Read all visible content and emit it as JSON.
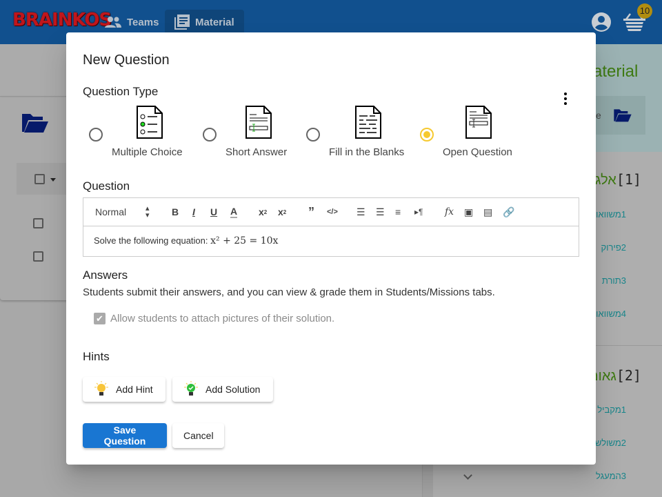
{
  "app": {
    "logo": "BRAINKOS",
    "nav": [
      {
        "label": "Teams",
        "icon": "people-icon"
      },
      {
        "label": "Material",
        "icon": "library-books-icon",
        "active": true
      }
    ],
    "cart_count": "10"
  },
  "background": {
    "right_title": "Material",
    "search_placeholder_fragment": "e",
    "sections": [
      {
        "num": "[1]",
        "title": "אלג",
        "items": [
          "1משוואו",
          "2פירוק ",
          "3תורת ",
          "4משוואו"
        ]
      },
      {
        "num": "[2]",
        "title": "גאומ",
        "items": [
          "1מקביל",
          "2משולש",
          "3המעגל"
        ]
      }
    ]
  },
  "dialog": {
    "title": "New Question",
    "question_type_label": "Question Type",
    "types": [
      {
        "label": "Multiple Choice",
        "selected": false
      },
      {
        "label": "Short Answer",
        "selected": false
      },
      {
        "label": "Fill in the Blanks",
        "selected": false
      },
      {
        "label": "Open Question",
        "selected": true
      }
    ],
    "question_label": "Question",
    "toolbar": {
      "format": "Normal"
    },
    "question_text": "Solve the following equation: ",
    "question_math": "x² + 25 = 10x",
    "answers_label": "Answers",
    "answers_desc": "Students submit their answers, and you can view & grade them in Students/Missions tabs.",
    "allow_pictures_label": "Allow students to attach pictures of their solution.",
    "allow_pictures_checked": true,
    "hints_label": "Hints",
    "add_hint": "Add Hint",
    "add_solution": "Add Solution",
    "save": "Save Question",
    "cancel": "Cancel",
    "colors": {
      "primary": "#1976d2",
      "radio_selected": "#f6c930"
    }
  }
}
